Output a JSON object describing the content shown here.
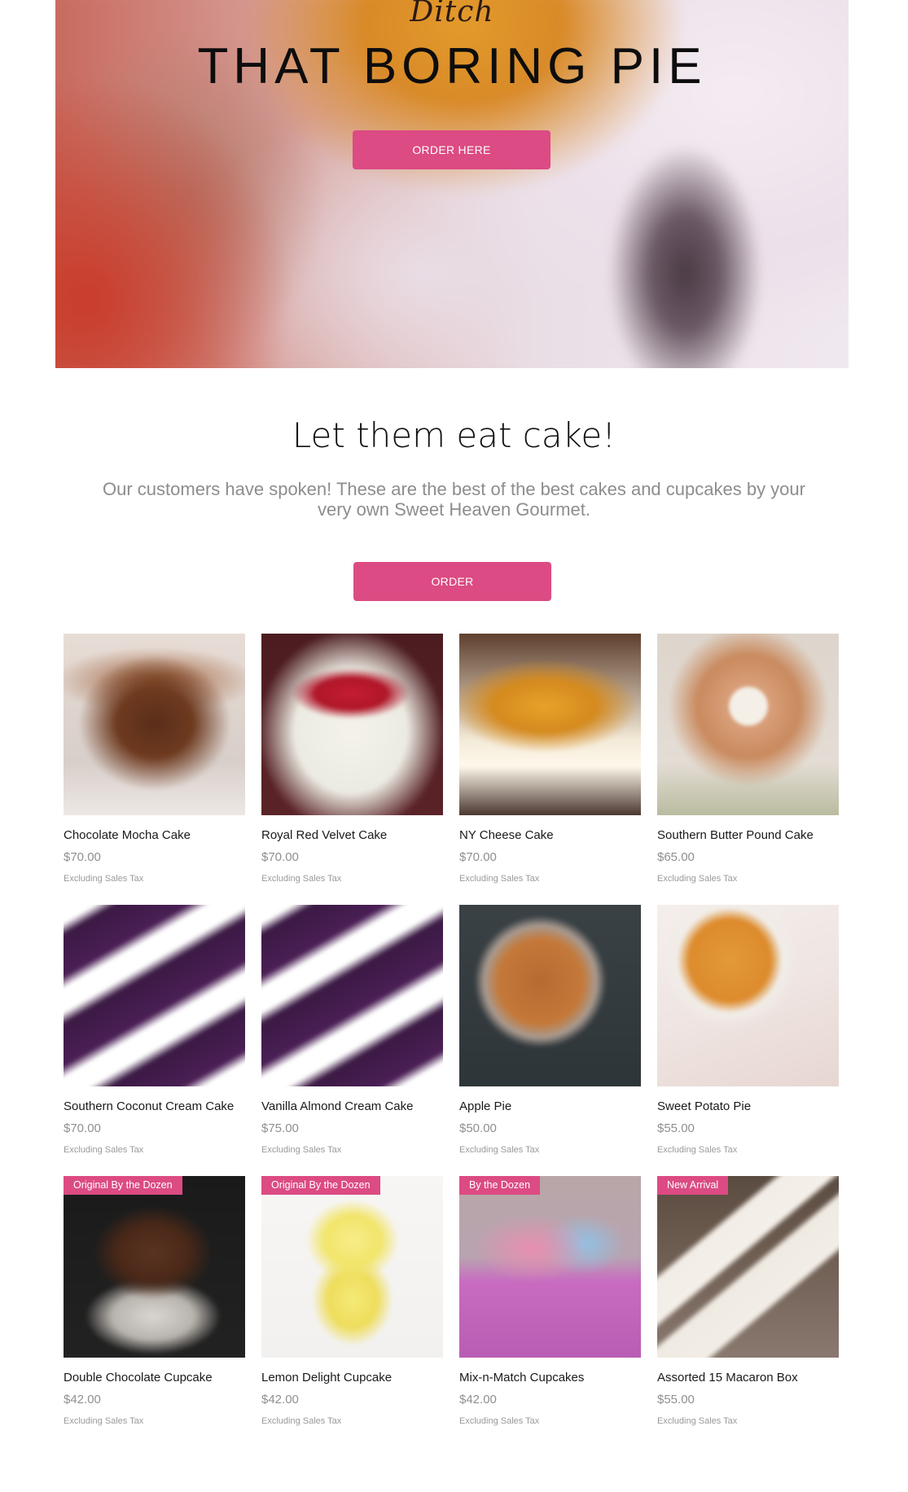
{
  "hero": {
    "kicker": "Ditch",
    "title": "THAT BORING PIE",
    "button_label": "ORDER HERE"
  },
  "intro": {
    "headline": "Let them eat cake!",
    "subtext": "Our customers have spoken! These are the best of the best cakes and cupcakes by your very own Sweet Heaven Gourmet.",
    "button_label": "ORDER"
  },
  "colors": {
    "accent": "#dc4b83"
  },
  "products": [
    {
      "name": "Chocolate Mocha Cake",
      "price": "$70.00",
      "tax_note": "Excluding Sales Tax",
      "ribbon": ""
    },
    {
      "name": "Royal Red Velvet Cake",
      "price": "$70.00",
      "tax_note": "Excluding Sales Tax",
      "ribbon": ""
    },
    {
      "name": "NY Cheese Cake",
      "price": "$70.00",
      "tax_note": "Excluding Sales Tax",
      "ribbon": ""
    },
    {
      "name": "Southern Butter Pound Cake",
      "price": "$65.00",
      "tax_note": "Excluding Sales Tax",
      "ribbon": ""
    },
    {
      "name": "Southern Coconut Cream Cake",
      "price": "$70.00",
      "tax_note": "Excluding Sales Tax",
      "ribbon": ""
    },
    {
      "name": "Vanilla Almond Cream Cake",
      "price": "$75.00",
      "tax_note": "Excluding Sales Tax",
      "ribbon": ""
    },
    {
      "name": "Apple Pie",
      "price": "$50.00",
      "tax_note": "Excluding Sales Tax",
      "ribbon": ""
    },
    {
      "name": "Sweet Potato Pie",
      "price": "$55.00",
      "tax_note": "Excluding Sales Tax",
      "ribbon": ""
    },
    {
      "name": "Double Chocolate Cupcake",
      "price": "$42.00",
      "tax_note": "Excluding Sales Tax",
      "ribbon": "Original By the Dozen"
    },
    {
      "name": "Lemon Delight Cupcake",
      "price": "$42.00",
      "tax_note": "Excluding Sales Tax",
      "ribbon": "Original By the Dozen"
    },
    {
      "name": "Mix-n-Match Cupcakes",
      "price": "$42.00",
      "tax_note": "Excluding Sales Tax",
      "ribbon": "By the Dozen"
    },
    {
      "name": "Assorted 15 Macaron Box",
      "price": "$55.00",
      "tax_note": "Excluding Sales Tax",
      "ribbon": "New Arrival"
    }
  ]
}
